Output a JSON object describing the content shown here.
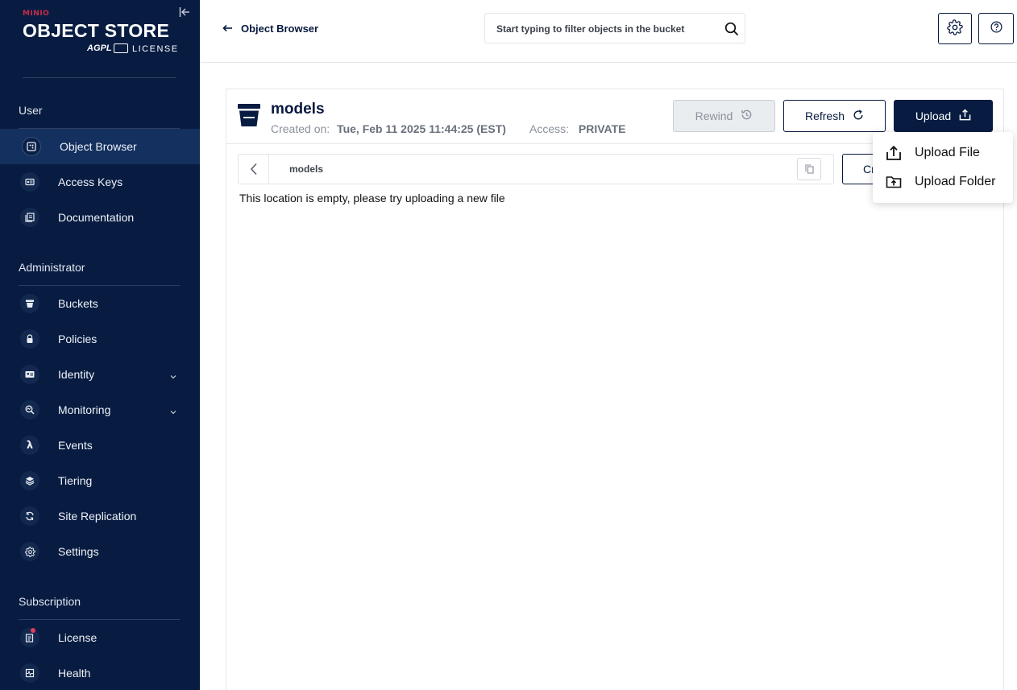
{
  "brand": {
    "top": "MINIO",
    "product": "OBJECT STORE",
    "badge": "AGPL",
    "license": "LICENSE"
  },
  "sidebar": {
    "sections": [
      {
        "title": "User"
      },
      {
        "title": "Administrator"
      },
      {
        "title": "Subscription"
      }
    ],
    "items": [
      {
        "label": "Object Browser",
        "icon": "object-browser-icon",
        "active": true
      },
      {
        "label": "Access Keys",
        "icon": "access-keys-icon"
      },
      {
        "label": "Documentation",
        "icon": "documentation-icon"
      },
      {
        "label": "Buckets",
        "icon": "bucket-icon"
      },
      {
        "label": "Policies",
        "icon": "policy-icon"
      },
      {
        "label": "Identity",
        "icon": "identity-icon",
        "expandable": true
      },
      {
        "label": "Monitoring",
        "icon": "monitoring-icon",
        "expandable": true
      },
      {
        "label": "Events",
        "icon": "lambda-icon"
      },
      {
        "label": "Tiering",
        "icon": "tiers-icon"
      },
      {
        "label": "Site Replication",
        "icon": "replication-icon"
      },
      {
        "label": "Settings",
        "icon": "gear-icon"
      },
      {
        "label": "License",
        "icon": "license-icon",
        "notification": true
      },
      {
        "label": "Health",
        "icon": "health-icon"
      }
    ]
  },
  "header": {
    "back_label": "Object Browser",
    "search_placeholder": "Start typing to filter objects in the bucket"
  },
  "bucket": {
    "name": "models",
    "created_label": "Created on:",
    "created_value": "Tue, Feb 11 2025 11:44:25 (EST)",
    "access_label": "Access:",
    "access_value": "PRIVATE"
  },
  "actions": {
    "rewind": "Rewind",
    "refresh": "Refresh",
    "upload": "Upload",
    "create_partial": "Cr"
  },
  "breadcrumb": {
    "path": "models"
  },
  "empty_message": "This location is empty, please try uploading a new file",
  "upload_menu": {
    "items": [
      "Upload File",
      "Upload Folder"
    ]
  },
  "colors": {
    "sidebar_bg": "#081c42",
    "active_bg": "#14305f",
    "primary": "#081c42",
    "notification": "#e23b57"
  }
}
